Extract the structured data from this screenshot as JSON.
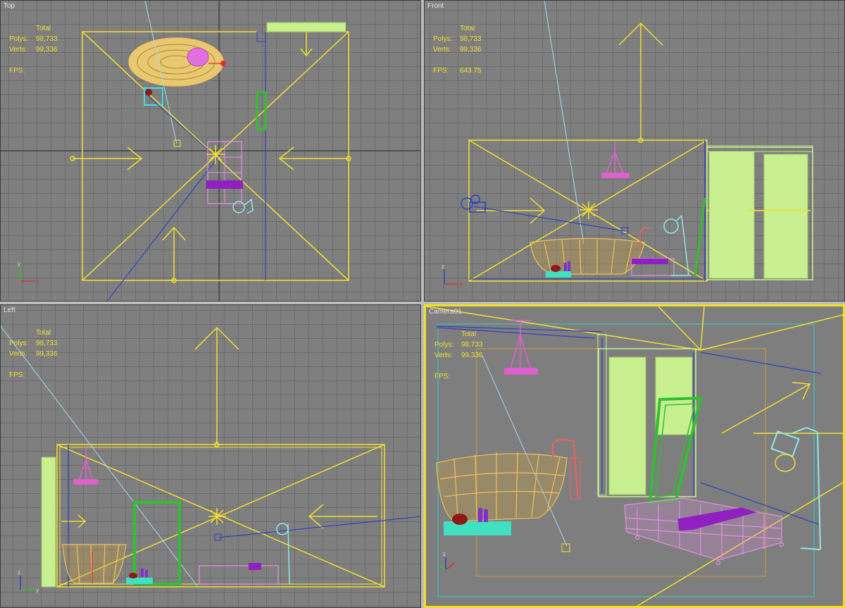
{
  "viewports": {
    "top": {
      "label": "Top",
      "stats": {
        "total_label": "Total",
        "polys_label": "Polys:",
        "polys_value": "98,733",
        "verts_label": "Verts:",
        "verts_value": "99,336",
        "fps_label": "FPS:",
        "fps_value": ""
      }
    },
    "front": {
      "label": "Front",
      "stats": {
        "total_label": "Total",
        "polys_label": "Polys:",
        "polys_value": "98,733",
        "verts_label": "Verts:",
        "verts_value": "99,336",
        "fps_label": "FPS:",
        "fps_value": "643.75"
      }
    },
    "left": {
      "label": "Left",
      "stats": {
        "total_label": "Total",
        "polys_label": "Polys:",
        "polys_value": "98,733",
        "verts_label": "Verts:",
        "verts_value": "99,336",
        "fps_label": "FPS:",
        "fps_value": ""
      }
    },
    "camera": {
      "label": "Camera01",
      "stats": {
        "total_label": "Total",
        "polys_label": "Polys:",
        "polys_value": "98,733",
        "verts_label": "Verts:",
        "verts_value": "99,336",
        "fps_label": "FPS:",
        "fps_value": ""
      }
    }
  },
  "axis_labels": {
    "x": "x",
    "y": "y",
    "z": "z"
  },
  "colors": {
    "grid_bg": "#7f7f7f",
    "grid_line": "#6c6c6c",
    "grid_axis": "#2e2e2e",
    "light_gizmo": "#f0e030",
    "tub": "#f0c060",
    "curtain": "#c8f090",
    "mirror": "#30c030",
    "rug": "#e090e0",
    "rug_accent": "#9020c0",
    "lamp": "#90e8e8",
    "faucet": "#f06060",
    "camera_line": "#3040c0",
    "target_line": "#a8d8f0",
    "active_border": "#f0e020"
  }
}
